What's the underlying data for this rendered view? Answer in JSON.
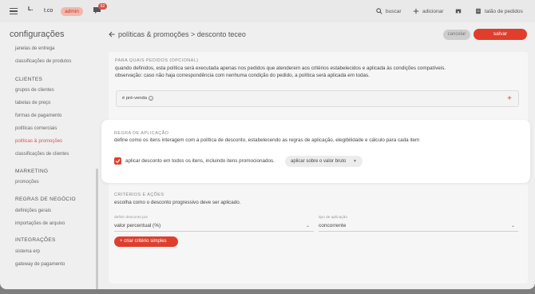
{
  "topbar": {
    "store_logo": "L.",
    "store_name": "t.co",
    "admin_badge": "admin",
    "chat_count": "62",
    "search_label": "buscar",
    "add_label": "adicionar",
    "talao_label": "talão de pedidos"
  },
  "sidebar": {
    "title": "configurações",
    "items_top": [
      "janelas de entrega",
      "classificações de produtos"
    ],
    "clientes_head": "CLIENTES",
    "clientes": [
      "grupos de clientes",
      "tabelas de preço",
      "formas de pagamento",
      "políticas comerciais",
      "políticas & promoções",
      "classificações de clientes"
    ],
    "marketing_head": "MARKETING",
    "marketing": [
      "promoções"
    ],
    "regras_head": "REGRAS DE NEGÓCIO",
    "regras": [
      "definições gerais",
      "importações de arquivo"
    ],
    "integracoes_head": "INTEGRAÇÕES",
    "integracoes": [
      "sistema erp",
      "gateway de pagamento"
    ]
  },
  "header": {
    "breadcrumb": "políticas & promoções > desconto teceo",
    "cancel_label": "cancelar",
    "save_label": "salvar"
  },
  "pedidos": {
    "label": "PARA QUAIS PEDIDOS (OPCIONAL)",
    "line1": "quando definidos, esta política será executada apenas nos pedidos que atenderem aos critérios estabelecidos e aplicada às condições compatíveis.",
    "line2": "observação: caso não haja correspondência com nenhuma condição do pedido, a política será aplicada em todas.",
    "chip": "é pré-venda",
    "chip_remove": "×",
    "add_icon": "+"
  },
  "regra": {
    "label": "REGRA DE APLICAÇÃO",
    "description": "define como os itens interagem com a política de desconto, estabelecendo as regras de aplicação, elegibilidade e cálculo para cada item",
    "checkbox_label": "aplicar desconto em todos os itens, incluindo itens promocionados.",
    "checked": true,
    "select_value": "aplicar sobre o valor bruto"
  },
  "criterios": {
    "label": "CRITÉRIOS E AÇÕES",
    "description": "escolha como o desconto progressivo deve ser aplicado.",
    "field1_label": "definir desconto por",
    "field1_value": "valor percentual (%)",
    "field2_label": "tipo de aplicação",
    "field2_value": "concorrente",
    "button_label": "criar critério simples"
  },
  "colors": {
    "accent": "#e03e2d",
    "active_text": "#d9534f"
  }
}
